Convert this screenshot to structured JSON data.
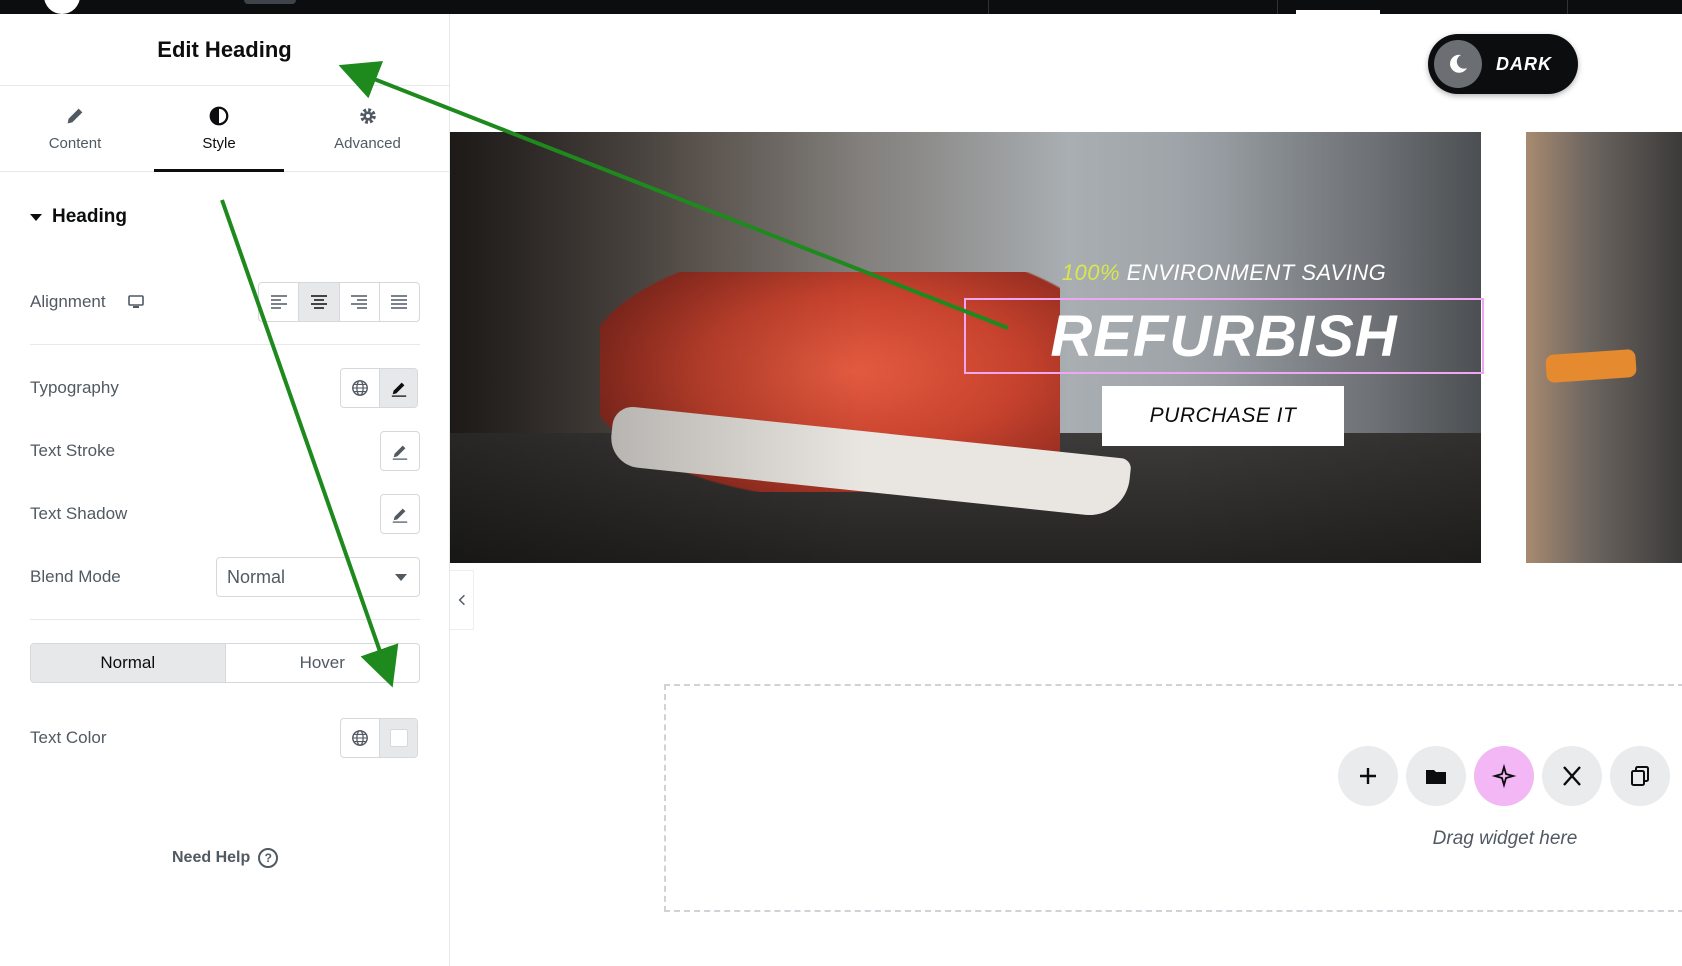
{
  "panel": {
    "title": "Edit Heading",
    "tabs": [
      {
        "label": "Content",
        "icon": "pencil-icon"
      },
      {
        "label": "Style",
        "icon": "contrast-icon"
      },
      {
        "label": "Advanced",
        "icon": "gear-icon"
      }
    ],
    "active_tab": "Style",
    "section_title": "Heading",
    "rows": {
      "alignment": "Alignment",
      "typography": "Typography",
      "text_stroke": "Text Stroke",
      "text_shadow": "Text Shadow",
      "blend_mode": "Blend Mode",
      "text_color": "Text Color"
    },
    "alignment_selected": "center",
    "blend_mode_value": "Normal",
    "state_tabs": [
      "Normal",
      "Hover"
    ],
    "active_state": "Normal",
    "need_help": "Need Help"
  },
  "canvas": {
    "dark_toggle": "DARK",
    "kicker_highlight": "100%",
    "kicker_rest": " ENVIRONMENT SAVING",
    "headline": "REFURBISH",
    "button": "PURCHASE IT",
    "drop_label": "Drag widget here",
    "drop_buttons": [
      "plus-icon",
      "folder-icon",
      "ai-sparkle-icon",
      "x-logo-icon",
      "copy-icon"
    ]
  },
  "colors": {
    "accent_pink": "#f3b7f5",
    "selection_border": "#f0a6f0",
    "kicker_highlight": "#d8e84a",
    "annotation_arrow": "#1e8a1e"
  }
}
